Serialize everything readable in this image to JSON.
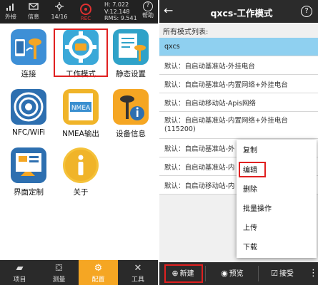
{
  "left": {
    "status": {
      "items": [
        {
          "icon": "antenna-icon",
          "glyph": "📶",
          "label": "外接"
        },
        {
          "icon": "message-icon",
          "glyph": "✉",
          "label": "信息"
        },
        {
          "icon": "satellite-icon",
          "glyph": "✲",
          "label": "14/16"
        }
      ],
      "record_label": "REC",
      "h_value": "H: 7.022",
      "v_value": "V:12.148",
      "rms_value": "RMS: 9.541",
      "help_label": "帮助",
      "help_glyph": "?"
    },
    "tiles": [
      {
        "label": "连接"
      },
      {
        "label": "工作模式"
      },
      {
        "label": "静态设置"
      },
      {
        "label": "NFC/WiFi"
      },
      {
        "label": "NMEA输出",
        "badge": "NMEA"
      },
      {
        "label": "设备信息"
      },
      {
        "label": "界面定制"
      },
      {
        "label": "关于"
      }
    ],
    "nav": [
      {
        "label": "项目",
        "glyph": "▰"
      },
      {
        "label": "测量",
        "glyph": "⛋"
      },
      {
        "label": "配置",
        "glyph": "⚙"
      },
      {
        "label": "工具",
        "glyph": "✕"
      }
    ],
    "active_nav": "配置"
  },
  "right": {
    "title": "qxcs-工作模式",
    "back_glyph": "←",
    "help_glyph": "?",
    "list_header": "所有模式列表:",
    "modes": [
      {
        "label": "qxcs",
        "selected": true
      },
      {
        "label": "默认：自启动基准站-外挂电台"
      },
      {
        "label": "默认：自启动基准站-内置网络+外挂电台"
      },
      {
        "label": "默认：自启动移动站-Apis网络"
      },
      {
        "label": "默认：自启动基准站-内置网络+外挂电台(115200)"
      },
      {
        "label": "默认：自启动基准站-外"
      },
      {
        "label": "默认：自启动基准站-内"
      },
      {
        "label": "默认：自启动移动站-内"
      }
    ],
    "context_menu": [
      "复制",
      "编辑",
      "删除",
      "批量操作",
      "上传",
      "下载"
    ],
    "bottom": {
      "new_label": "新建",
      "preview_label": "预览",
      "accept_label": "接受",
      "more_glyph": "⋮"
    }
  },
  "colors": {
    "highlight_red": "#e02020",
    "selected_row": "#8fd0f0",
    "nav_active": "#f5a623"
  }
}
